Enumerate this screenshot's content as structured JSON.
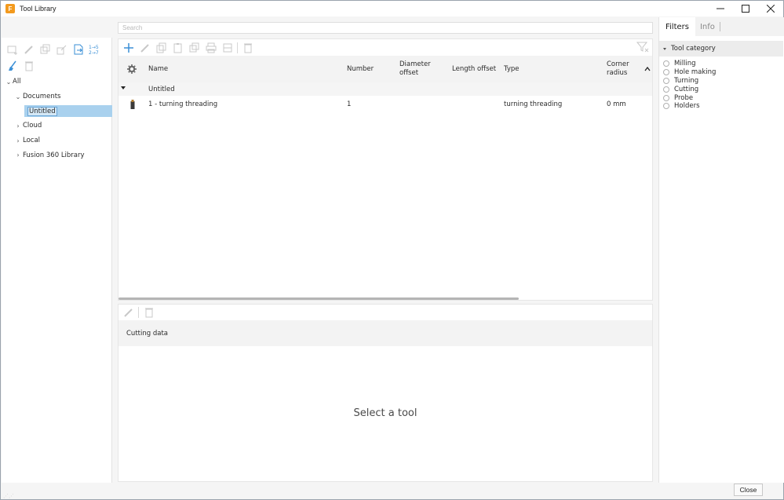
{
  "window": {
    "title": "Tool Library",
    "app_icon_letter": "F",
    "controls": {
      "minimize": "─",
      "maximize": "☐",
      "close": "✕"
    }
  },
  "search": {
    "placeholder": "Search"
  },
  "tree": {
    "items": [
      {
        "label": "All",
        "expanded": true,
        "level": 0
      },
      {
        "label": "Documents",
        "expanded": true,
        "level": 1
      },
      {
        "label": "Untitled",
        "selected": true,
        "level": 2
      },
      {
        "label": "Cloud",
        "expanded": false,
        "level": 1
      },
      {
        "label": "Local",
        "expanded": false,
        "level": 1
      },
      {
        "label": "Fusion 360 Library",
        "expanded": false,
        "level": 1
      }
    ]
  },
  "table": {
    "columns": {
      "name": "Name",
      "number": "Number",
      "diameter_offset_1": "Diameter",
      "diameter_offset_2": "offset",
      "length_offset": "Length offset",
      "type": "Type",
      "corner_radius_1": "Corner",
      "corner_radius_2": "radius"
    },
    "group": "Untitled",
    "rows": [
      {
        "name": "1 - turning threading",
        "number": "1",
        "diameter_offset": "",
        "length_offset": "",
        "type": "turning threading",
        "corner_radius": "0 mm"
      }
    ]
  },
  "cutting": {
    "header": "Cutting data",
    "empty_message": "Select a tool"
  },
  "right_panel": {
    "tabs": {
      "filters": "Filters",
      "info": "Info"
    },
    "category_header": "Tool category",
    "categories": [
      "Milling",
      "Hole making",
      "Turning",
      "Cutting",
      "Probe",
      "Holders"
    ]
  },
  "footer": {
    "close_label": "Close"
  },
  "colors": {
    "accent": "#3a8fd6",
    "selection": "#a9d1ee",
    "app_icon": "#f39a1e"
  }
}
